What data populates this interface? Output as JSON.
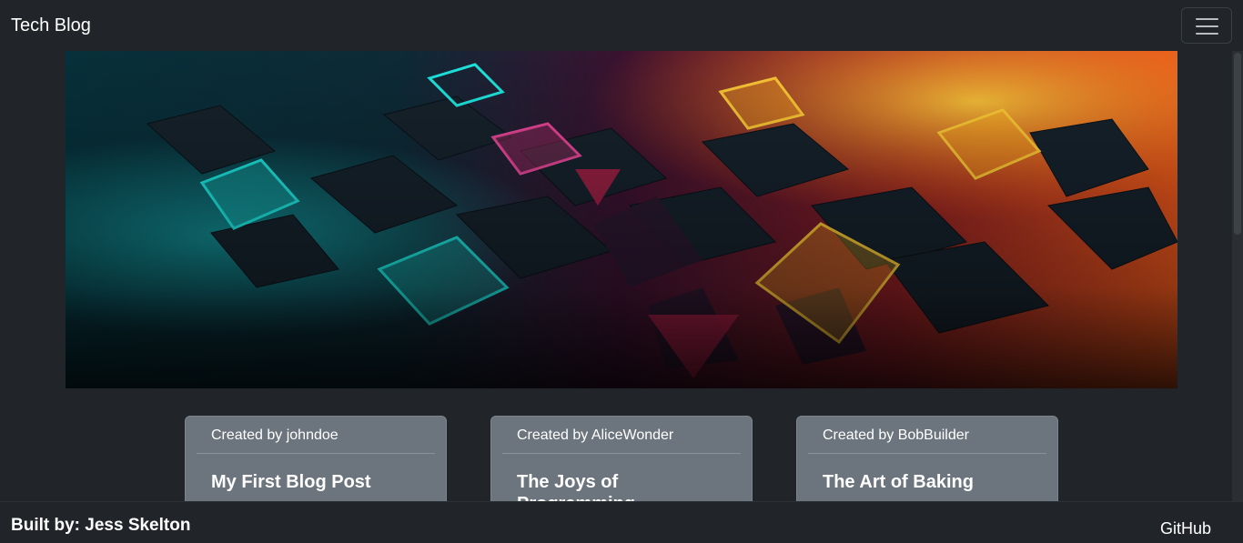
{
  "navbar": {
    "brand": "Tech Blog",
    "toggler_icon": "hamburger-menu-icon"
  },
  "hero": {
    "description_icon": "abstract-neon-cubes-image",
    "colors": [
      "#10d9d9",
      "#e0357a",
      "#ffb020",
      "#ff4a1a"
    ]
  },
  "posts": [
    {
      "author_label": "Created by johndoe",
      "title": "My First Blog Post"
    },
    {
      "author_label": "Created by AliceWonder",
      "title": "The Joys of Programming"
    },
    {
      "author_label": "Created by BobBuilder",
      "title": "The Art of Baking"
    }
  ],
  "footer": {
    "built_by": "Built by: Jess Skelton",
    "link_label": "GitHub"
  },
  "theme": {
    "background": "#212529",
    "card_background": "#6c757d"
  }
}
